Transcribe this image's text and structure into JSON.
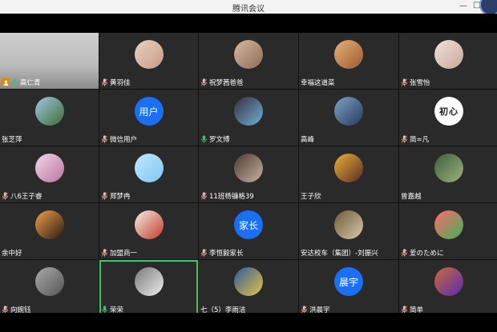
{
  "window": {
    "title": "腾讯会议",
    "min_glyph": "—",
    "max_glyph": "□"
  },
  "colors": {
    "active_border": "#2ecc71",
    "avatar_blue": "#1b6ff5",
    "host_badge": "#e58a00",
    "mic_on": "#2ecc71",
    "mic_off": "#cccccc"
  },
  "participants": [
    {
      "name": "高仁青",
      "mic": "on",
      "host": true,
      "video": true
    },
    {
      "name": "黄羽佳",
      "mic": "off",
      "avatar": "photo"
    },
    {
      "name": "祝梦茜爸爸",
      "mic": "off",
      "avatar": "photo"
    },
    {
      "name": "幸福这道菜",
      "mic": "none",
      "avatar": "photo"
    },
    {
      "name": "张雪怡",
      "mic": "off",
      "avatar": "photo"
    },
    {
      "name": "张芝萍",
      "mic": "none",
      "avatar": "photo"
    },
    {
      "name": "微信用户",
      "mic": "off",
      "avatar": "text",
      "avatar_text": "用户"
    },
    {
      "name": "罗文博",
      "mic": "on",
      "avatar": "photo"
    },
    {
      "name": "高峰",
      "mic": "none",
      "avatar": "photo"
    },
    {
      "name": "简=凡",
      "mic": "off",
      "avatar": "text",
      "avatar_text": "初心"
    },
    {
      "name": "八6王子睿",
      "mic": "off",
      "avatar": "photo"
    },
    {
      "name": "郑梦冉",
      "mic": "off",
      "avatar": "photo"
    },
    {
      "name": "11班杨镰格39",
      "mic": "off",
      "avatar": "photo"
    },
    {
      "name": "王子欣",
      "mic": "none",
      "avatar": "photo"
    },
    {
      "name": "曾嘉越",
      "mic": "none",
      "avatar": "photo"
    },
    {
      "name": "余中好",
      "mic": "none",
      "avatar": "photo"
    },
    {
      "name": "加盟商一",
      "mic": "off",
      "avatar": "photo"
    },
    {
      "name": "李恒毅家长",
      "mic": "off",
      "avatar": "text",
      "avatar_text": "家长"
    },
    {
      "name": "安达校车（集团）-刘振兴",
      "mic": "none",
      "avatar": "photo"
    },
    {
      "name": "爱のために",
      "mic": "off",
      "avatar": "photo"
    },
    {
      "name": "向婉钰",
      "mic": "off",
      "avatar": "photo"
    },
    {
      "name": "荣荣",
      "mic": "on",
      "avatar": "photo",
      "active": true
    },
    {
      "name": "七（5）李雨洁",
      "mic": "none",
      "avatar": "photo"
    },
    {
      "name": "洪晨宇",
      "mic": "off",
      "avatar": "text",
      "avatar_text": "晨宇"
    },
    {
      "name": "简单",
      "mic": "off",
      "avatar": "photo"
    }
  ]
}
